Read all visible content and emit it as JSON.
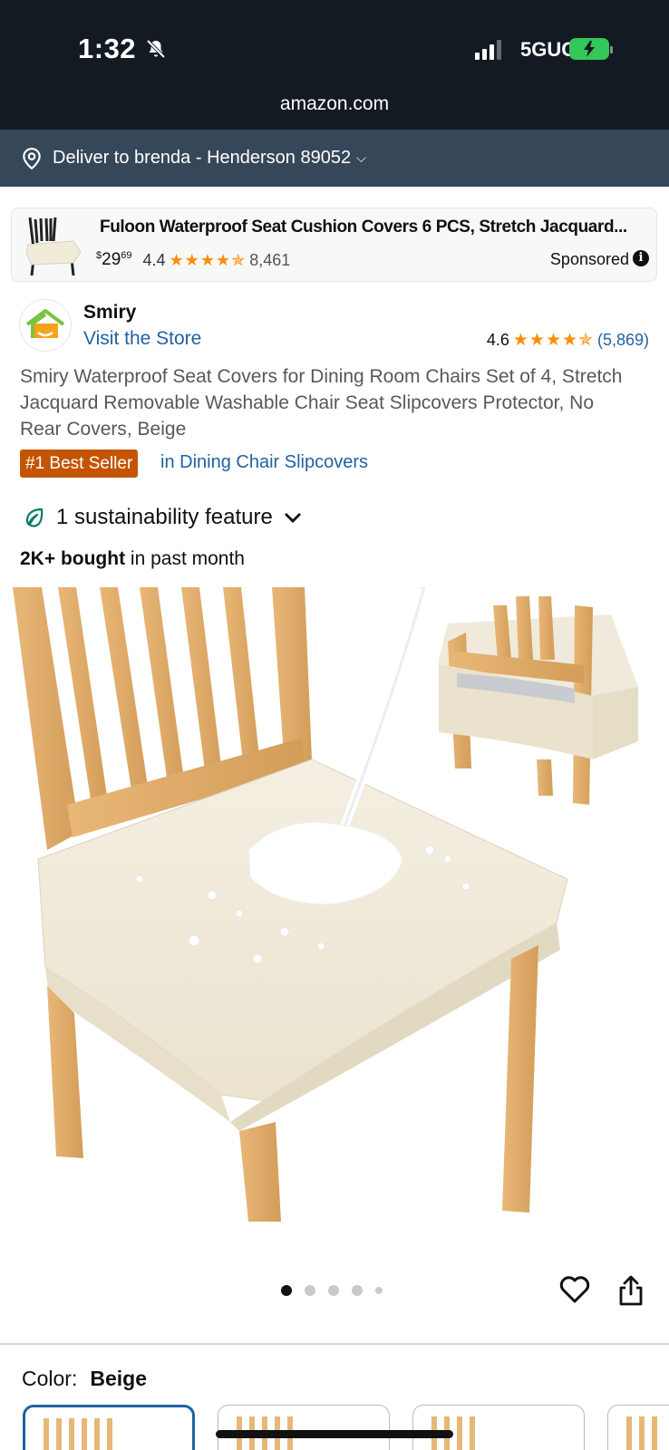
{
  "status_bar": {
    "time": "1:32",
    "network": "5GUC"
  },
  "browser": {
    "url": "amazon.com"
  },
  "deliver": {
    "text": "Deliver to brenda - Henderson 89052"
  },
  "sponsored": {
    "title": "Fuloon Waterproof Seat Cushion Covers 6 PCS, Stretch Jacquard...",
    "price_symbol": "$",
    "price_dollars": "29",
    "price_cents": "69",
    "rating": "4.4",
    "stars": "★★★★✯",
    "review_count": "8,461",
    "label": "Sponsored"
  },
  "brand": {
    "name": "Smiry",
    "visit_store": "Visit the Store",
    "rating": "4.6",
    "stars": "★★★★✯",
    "review_count": "(5,869)"
  },
  "product": {
    "title": "Smiry Waterproof Seat Covers for Dining Room Chairs Set of 4, Stretch Jacquard Removable Washable Chair Seat Slipcovers Protector, No Rear Covers, Beige",
    "badge": "#1 Best Seller",
    "badge_category": "in Dining Chair Slipcovers",
    "sustainability": "1 sustainability feature",
    "bought_bold": "2K+ bought",
    "bought_rest": " in past month",
    "image_count": 5,
    "active_image": 0
  },
  "color": {
    "label": "Color:",
    "value": "Beige"
  },
  "colors": {
    "accent": "#2162a1",
    "badge": "#c45500",
    "star": "#ff8c00",
    "header": "#131a22",
    "deliver_bar": "#37475a"
  }
}
